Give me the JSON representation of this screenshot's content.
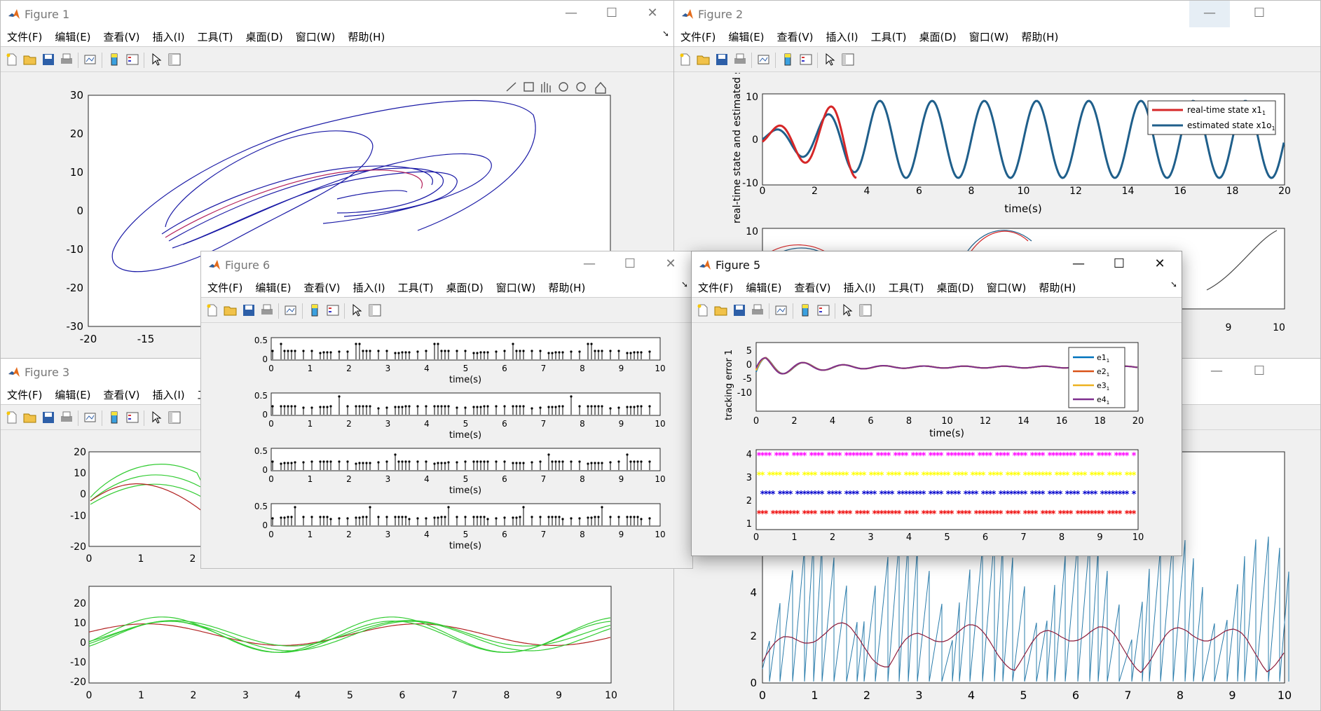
{
  "menu": {
    "file": "文件(F)",
    "edit": "编辑(E)",
    "view": "查看(V)",
    "insert": "插入(I)",
    "tools": "工具(T)",
    "desktop": "桌面(D)",
    "window": "窗口(W)",
    "help": "帮助(H)"
  },
  "fig1": {
    "title": "Figure 1",
    "x_ticks": [
      "-20",
      "-15"
    ],
    "y_ticks": [
      "30",
      "20",
      "10",
      "0",
      "-10",
      "-20",
      "-30"
    ]
  },
  "fig2": {
    "title": "Figure 2",
    "ylabel": "real-time state and estimated st",
    "xlabel": "time(s)",
    "x_ticks": [
      "0",
      "2",
      "4",
      "6",
      "8",
      "10",
      "12",
      "14",
      "16",
      "18",
      "20"
    ],
    "y_ticks": [
      "10",
      "0",
      "-10"
    ],
    "y_ticks2": [
      "10"
    ],
    "x_ticks2": [
      "9",
      "10"
    ],
    "legend": [
      {
        "label": "real-time state x1",
        "sub": "1",
        "color": "#d62728"
      },
      {
        "label": "estimated state x1o",
        "sub": "1",
        "color": "#1f5f8b"
      }
    ]
  },
  "fig3": {
    "title": "Figure 3",
    "y_ticks_a": [
      "20",
      "10",
      "0",
      "-10",
      "-20"
    ],
    "x_ticks_a": [
      "0",
      "1",
      "2"
    ],
    "y_ticks_b": [
      "20",
      "10",
      "0",
      "-10",
      "-20"
    ],
    "x_ticks_b": [
      "0",
      "1",
      "2",
      "3",
      "4",
      "5",
      "6",
      "7",
      "8",
      "9",
      "10"
    ]
  },
  "fig4": {
    "y_ticks": [
      "4",
      "2",
      "0"
    ],
    "x_ticks": [
      "0",
      "1",
      "2",
      "3",
      "4",
      "5",
      "6",
      "7",
      "8",
      "9",
      "10"
    ]
  },
  "fig6": {
    "title": "Figure 6",
    "xlabel": "time(s)",
    "y_ticks": [
      "0.5",
      "0"
    ],
    "x_ticks": [
      "0",
      "1",
      "2",
      "3",
      "4",
      "5",
      "6",
      "7",
      "8",
      "9",
      "10"
    ]
  },
  "fig5": {
    "title": "Figure 5",
    "ylabel": "tracking error 1",
    "xlabel": "time(s)",
    "x_ticks_top": [
      "0",
      "2",
      "4",
      "6",
      "8",
      "10",
      "12",
      "14",
      "16",
      "18",
      "20"
    ],
    "y_ticks_top": [
      "5",
      "0",
      "-5",
      "-10"
    ],
    "x_ticks_bot": [
      "0",
      "1",
      "2",
      "3",
      "4",
      "5",
      "6",
      "7",
      "8",
      "9",
      "10"
    ],
    "y_ticks_bot": [
      "4",
      "3",
      "2",
      "1"
    ],
    "legend": [
      {
        "label": "e1",
        "sub": "1",
        "color": "#0072bd"
      },
      {
        "label": "e2",
        "sub": "1",
        "color": "#d95319"
      },
      {
        "label": "e3",
        "sub": "1",
        "color": "#edb120"
      },
      {
        "label": "e4",
        "sub": "1",
        "color": "#7e2f8e"
      }
    ],
    "markers": [
      {
        "level": 4,
        "color": "#ff00ff"
      },
      {
        "level": 3,
        "color": "#ffff00"
      },
      {
        "level": 2,
        "color": "#0000cc"
      },
      {
        "level": 1,
        "color": "#ee0000"
      }
    ]
  }
}
